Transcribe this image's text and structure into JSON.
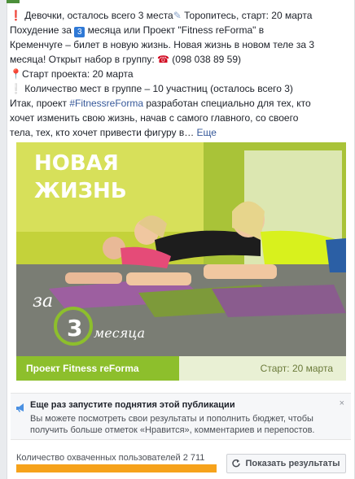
{
  "post": {
    "line1": "Девочки, осталось всего 3 места",
    "line1b": " Торопитесь, старт: 20 марта",
    "line2a": "Похудение за ",
    "num_badge": "3",
    "line2b": " месяца или Проект \"Fitness reForma\" в",
    "line3": "Кременчуге – билет в новую жизнь. Новая жизнь в новом теле за 3",
    "line4": "месяца! Открыт набор в группу: ",
    "phone": "(098 038 89 59)",
    "line5": "Старт проекта: 20 марта",
    "line6": "Количество мест в группе – 10 участниц (осталось всего 3)",
    "line7a": "Итак, проект ",
    "hashtag": "#FitnessreForma",
    "line7b": " разработан специально для тех, кто",
    "line8": "хочет изменить свою жизнь, начав с самого главного, со своего",
    "line9": "тела, тех, кто хочет привести фигуру в… ",
    "more": "Еще"
  },
  "image": {
    "headline1": "НОВАЯ",
    "headline2": "ЖИЗНЬ",
    "za": "за",
    "num": "3",
    "months": "месяца",
    "banner_left": "Проект Fitness reForma",
    "banner_right": "Старт: 20 марта",
    "accent": "#8dbf2c"
  },
  "promo": {
    "title": "Еще раз запустите поднятия этой публикации",
    "body": "Вы можете посмотреть свои результаты и пополнить бюджет, чтобы получить больше отметок «Нравится», комментариев и перепостов.",
    "close": "×",
    "icon": "megaphone-icon"
  },
  "reach": {
    "label": "Количество охваченных пользователей 2 711",
    "progress": 1.0
  },
  "button": {
    "label": "Показать результаты",
    "icon": "refresh-icon"
  }
}
